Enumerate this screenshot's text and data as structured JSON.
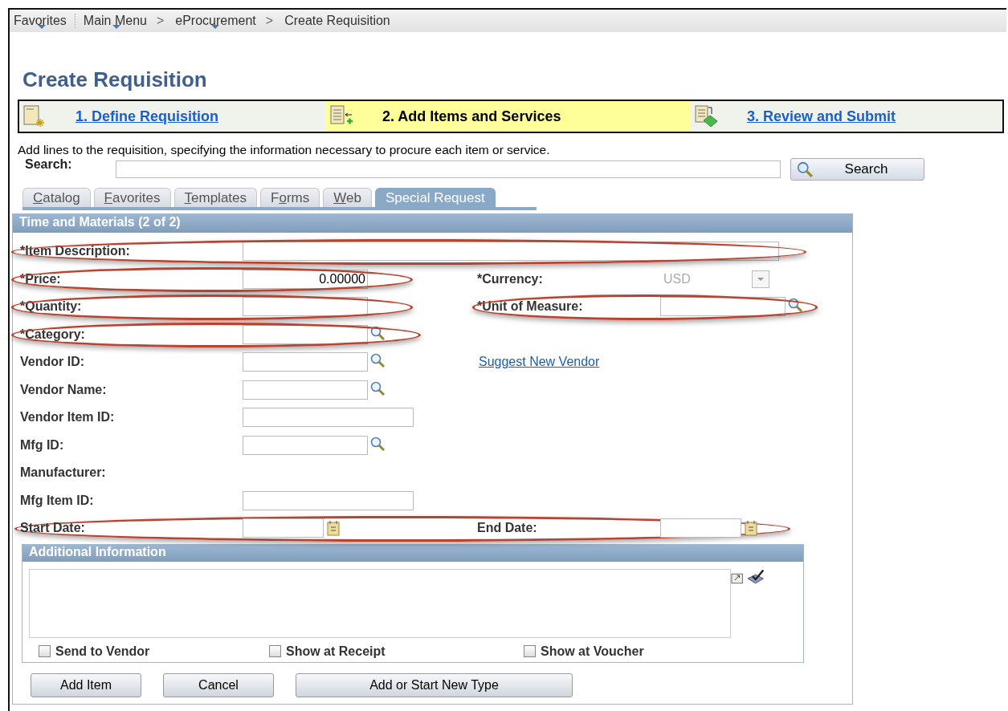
{
  "breadcrumb": [
    {
      "label": "Favorites",
      "menu": true,
      "divider": true
    },
    {
      "label": "Main Menu",
      "menu": true
    },
    {
      "label": "eProcurement",
      "menu": true,
      "separator": ">"
    },
    {
      "label": "Create Requisition",
      "menu": false,
      "separator": ">"
    }
  ],
  "page_title": "Create Requisition",
  "steps": [
    {
      "kind": "define",
      "label": "1. Define Requisition",
      "selected": false
    },
    {
      "kind": "add",
      "label": "2. Add Items and Services",
      "selected": true
    },
    {
      "kind": "review",
      "label": "3. Review and Submit",
      "selected": false
    }
  ],
  "instructions": "Add lines to the requisition, specifying the information necessary to procure each item or service.",
  "search": {
    "label": "Search:",
    "button": "Search"
  },
  "tabs": [
    {
      "parts": [
        {
          "text": "C",
          "underline": true
        },
        {
          "text": "atalog",
          "underline": false
        }
      ],
      "selected": false
    },
    {
      "parts": [
        {
          "text": "F",
          "underline": true
        },
        {
          "text": "avorites",
          "underline": false
        }
      ],
      "selected": false
    },
    {
      "parts": [
        {
          "text": "T",
          "underline": true
        },
        {
          "text": "emplates",
          "underline": false
        }
      ],
      "selected": false
    },
    {
      "parts": [
        {
          "text": "F",
          "underline": false
        },
        {
          "text": "o",
          "underline": true
        },
        {
          "text": "rms",
          "underline": false
        }
      ],
      "selected": false
    },
    {
      "parts": [
        {
          "text": "W",
          "underline": true
        },
        {
          "text": "eb",
          "underline": false
        }
      ],
      "selected": false
    },
    {
      "parts": [
        {
          "text": "Special Request",
          "underline": false
        }
      ],
      "selected": true
    }
  ],
  "section_title": "Time and Materials (2 of 2)",
  "rows": [
    {
      "highlighted": false,
      "cells": [
        {
          "label": "*Item Description:",
          "kind": "full",
          "highlighted": true
        }
      ]
    },
    {
      "highlighted": false,
      "cells": [
        {
          "label": "*Price:",
          "kind": "number",
          "value": "0.00000",
          "highlighted": true
        },
        {
          "label": "*Currency:",
          "kind": "dropdown",
          "value": "USD",
          "disabled": true,
          "highlighted": false
        }
      ]
    },
    {
      "highlighted": false,
      "cells": [
        {
          "label": "*Quantity:",
          "kind": "text",
          "highlighted": true
        },
        {
          "label": "*Unit of Measure:",
          "kind": "lookup",
          "highlighted": true
        }
      ]
    },
    {
      "highlighted": false,
      "cells": [
        {
          "label": "*Category:",
          "kind": "lookup",
          "highlighted": true
        }
      ]
    },
    {
      "highlighted": false,
      "cells": [
        {
          "label": "Vendor ID:",
          "kind": "lookup",
          "highlighted": false
        },
        {
          "label": "Suggest New Vendor",
          "kind": "link",
          "highlighted": false
        }
      ]
    },
    {
      "highlighted": false,
      "cells": [
        {
          "label": "Vendor Name:",
          "kind": "lookup",
          "highlighted": false
        }
      ]
    },
    {
      "highlighted": false,
      "cells": [
        {
          "label": "Vendor Item ID:",
          "kind": "wide",
          "highlighted": false
        }
      ]
    },
    {
      "highlighted": false,
      "cells": [
        {
          "label": "Mfg ID:",
          "kind": "lookup",
          "highlighted": false
        }
      ]
    },
    {
      "highlighted": false,
      "cells": [
        {
          "label": "Manufacturer:",
          "kind": "none",
          "highlighted": false
        }
      ]
    },
    {
      "highlighted": false,
      "cells": [
        {
          "label": "Mfg Item ID:",
          "kind": "wide",
          "highlighted": false
        }
      ]
    },
    {
      "highlighted": true,
      "cells": [
        {
          "label": "Start Date:",
          "kind": "date",
          "highlighted": false
        },
        {
          "label": "End Date:",
          "kind": "date",
          "highlighted": false
        }
      ]
    }
  ],
  "additional": {
    "title": "Additional Information",
    "checkboxes": [
      {
        "label": "Send to Vendor",
        "checked": false
      },
      {
        "label": "Show at Receipt",
        "checked": false
      },
      {
        "label": "Show at Voucher",
        "checked": false
      }
    ]
  },
  "buttons": [
    {
      "label": "Add Item"
    },
    {
      "label": "Cancel"
    },
    {
      "label": "Add or Start New Type"
    }
  ]
}
